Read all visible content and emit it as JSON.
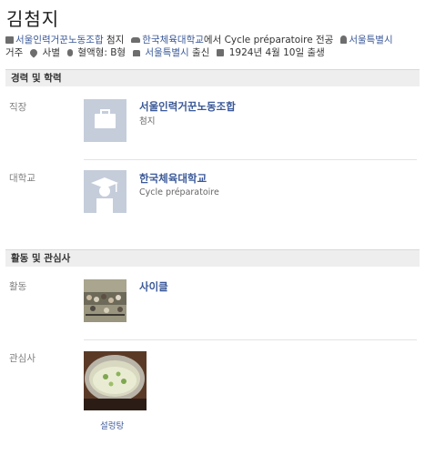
{
  "profile": {
    "name": "김첨지"
  },
  "info": {
    "workplace_link": "서울인력거꾼노동조합",
    "workplace_role": " 첨지",
    "school_link": "한국체육대학교",
    "school_suffix": "에서 Cycle préparatoire 전공",
    "lives_link": "서울특별시",
    "lives_suffix": "거주",
    "relationship": "사별",
    "blood_type": "혈액형: B형",
    "hometown_link": "서울특별시",
    "hometown_suffix": " 출신",
    "birthday": "1924년 4월 10일 출생"
  },
  "sections": {
    "career": {
      "title": "경력 및 학력",
      "work_label": "직장",
      "work_name": "서울인력거꾼노동조합",
      "work_role": "첨지",
      "college_label": "대학교",
      "college_name": "한국체육대학교",
      "college_program": "Cycle préparatoire"
    },
    "activities": {
      "title": "활동 및 관심사",
      "activity_label": "활동",
      "activity_name": "사이클",
      "interest_label": "관심사",
      "interest_name": "설렁탕"
    }
  },
  "icons": {
    "briefcase": "briefcase-icon",
    "car": "car-icon",
    "home": "home-icon",
    "heart": "heart-icon",
    "drop": "blood-drop-icon",
    "hometown": "hometown-icon",
    "calendar": "calendar-icon"
  },
  "colors": {
    "link": "#3b5998",
    "section_bg": "#eeeeee",
    "placeholder": "#c5cddb"
  }
}
